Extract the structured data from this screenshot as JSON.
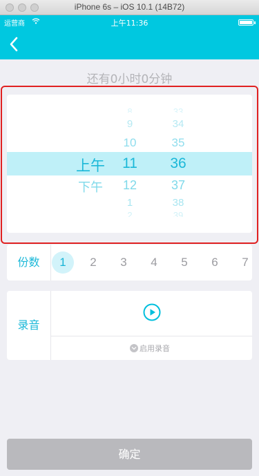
{
  "window": {
    "title": "iPhone 6s – iOS 10.1 (14B72)"
  },
  "status_bar": {
    "carrier": "运营商",
    "time": "上午11:36"
  },
  "remaining_time": "还有0小时0分钟",
  "time_picker": {
    "ampm": [
      {
        "label": "上午",
        "selected": true
      },
      {
        "label": "下午",
        "selected": false
      }
    ],
    "hours": [
      "8",
      "9",
      "10",
      "11",
      "12",
      "1",
      "2"
    ],
    "selected_hour": "11",
    "minutes": [
      "33",
      "34",
      "35",
      "36",
      "37",
      "38",
      "39"
    ],
    "selected_minute": "36"
  },
  "copies": {
    "label": "份数",
    "options": [
      "1",
      "2",
      "3",
      "4",
      "5",
      "6",
      "7"
    ],
    "selected": "1"
  },
  "recording": {
    "label": "录音",
    "enable_label": "启用录音"
  },
  "confirm_button": "确定",
  "colors": {
    "accent": "#00c8e0",
    "label": "#1bb8d8",
    "selection_band": "#bff0f8",
    "highlight_frame": "#e02020",
    "confirm_disabled": "#b9b9bd"
  }
}
